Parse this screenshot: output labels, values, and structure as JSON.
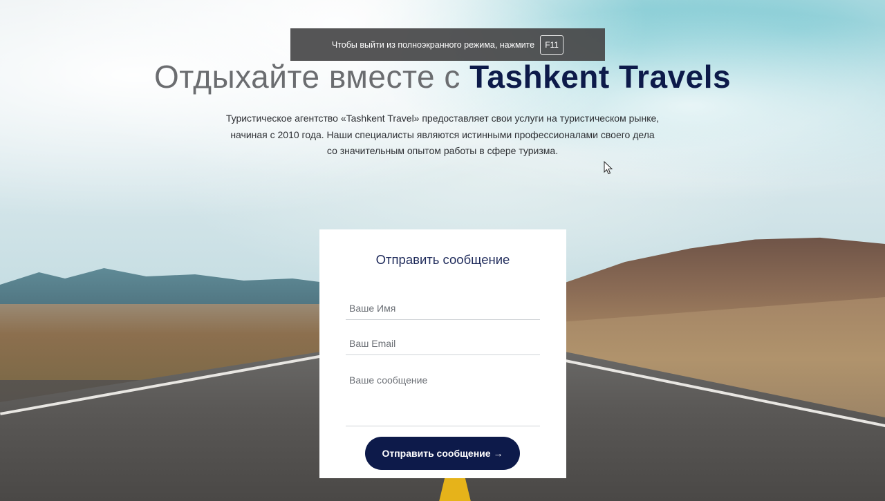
{
  "fullscreen_notice": {
    "text": "Чтобы выйти из полноэкранного режима, нажмите",
    "key": "F11"
  },
  "hero": {
    "title_prefix": "Отдыхайте вместе с ",
    "title_brand": "Tashkent Travels",
    "description": "Туристическое агентство «Tashkent Travel» предоставляет свои услуги на туристическом рынке, начиная с 2010 года. Наши специалисты являются истинными профессионалами своего дела со значительным опытом работы в сфере туризма."
  },
  "form": {
    "title": "Отправить сообщение",
    "name_placeholder": "Ваше Имя",
    "email_placeholder": "Ваш Email",
    "message_placeholder": "Ваше сообщение",
    "submit_label": "Отправить сообщение",
    "submit_arrow": "→"
  },
  "colors": {
    "brand_navy": "#0d1a4a",
    "notice_bg": "#464648",
    "card_bg": "#ffffff"
  },
  "icons": {
    "cursor": "mouse-pointer-icon"
  }
}
